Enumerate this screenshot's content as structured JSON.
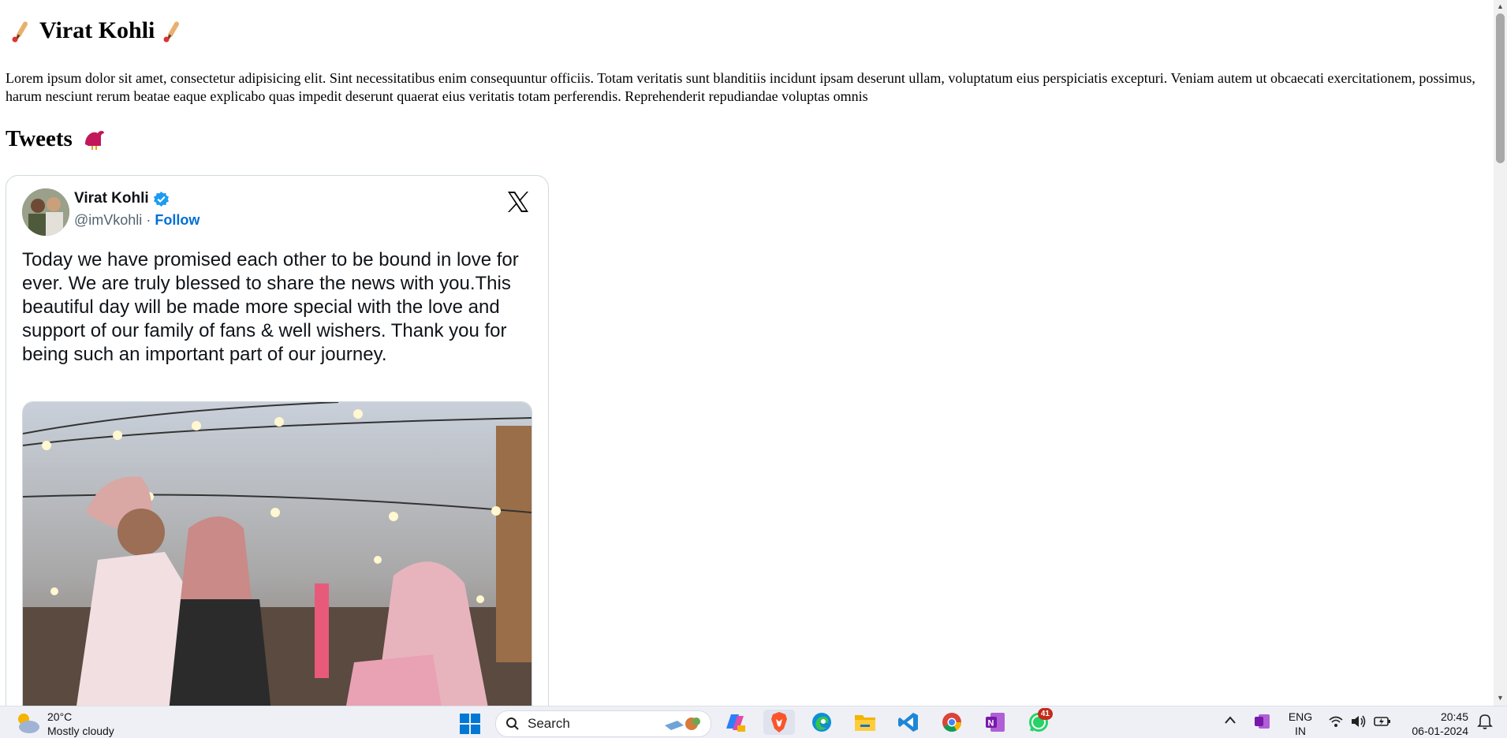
{
  "page": {
    "title": "Virat Kohli",
    "intro": "Lorem ipsum dolor sit amet, consectetur adipisicing elit. Sint necessitatibus enim consequuntur officiis. Totam veritatis sunt blanditiis incidunt ipsam deserunt ullam, voluptatum eius perspiciatis excepturi. Veniam autem ut obcaecati exercitationem, possimus, harum nesciunt rerum beatae eaque explicabo quas impedit deserunt quaerat eius veritatis totam perferendis. Reprehenderit repudiandae voluptas omnis",
    "tweets_heading": "Tweets"
  },
  "tweet": {
    "author_name": "Virat Kohli",
    "handle": "@imVkohli",
    "separator": "·",
    "follow_label": "Follow",
    "text": "Today we have promised each other to be bound in love for ever. We are truly blessed to share the news with you.This beautiful day will be made more special with the love and support of our family of fans & well wishers. Thank you for being such an important part of our journey.",
    "verified_color": "#1d9bf0",
    "follow_color": "#006fd6"
  },
  "taskbar": {
    "weather_temp": "20°C",
    "weather_desc": "Mostly cloudy",
    "search_label": "Search",
    "apps": [
      "copilot-icon",
      "brave-icon",
      "edge-icon",
      "file-explorer-icon",
      "vscode-icon",
      "chrome-icon",
      "onenote-icon",
      "whatsapp-icon"
    ],
    "whatsapp_badge": "41",
    "lang_line1": "ENG",
    "lang_line2": "IN",
    "time": "20:45",
    "date": "06-01-2024"
  }
}
